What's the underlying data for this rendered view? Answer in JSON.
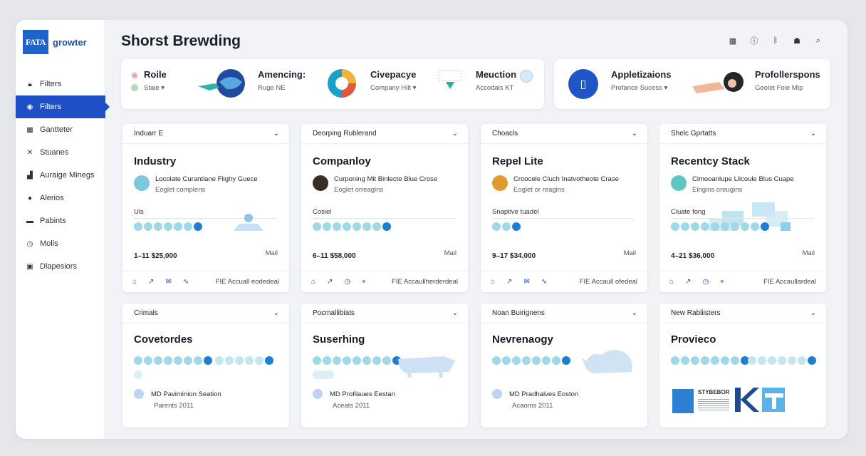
{
  "app": {
    "brand_logo": "FATA",
    "brand_name": "growter"
  },
  "page_title": "Shorst Brewding",
  "sidebar": {
    "items": [
      {
        "label": "Filters",
        "icon": "lock-icon",
        "active": false
      },
      {
        "label": "Filters",
        "icon": "filter-icon",
        "active": true
      },
      {
        "label": "Gantteter",
        "icon": "calendar-icon",
        "active": false
      },
      {
        "label": "Stuanes",
        "icon": "close-icon",
        "active": false
      },
      {
        "label": "Auraige Minegs",
        "icon": "chart-icon",
        "active": false
      },
      {
        "label": "Alerios",
        "icon": "user-icon",
        "active": false
      },
      {
        "label": "Pabints",
        "icon": "card-icon",
        "active": false
      },
      {
        "label": "Molis",
        "icon": "clock-icon",
        "active": false
      },
      {
        "label": "Dlapesiors",
        "icon": "gallery-icon",
        "active": false
      }
    ]
  },
  "top_icons": [
    "grid-icon",
    "info-icon",
    "bluetooth-icon",
    "group-icon",
    "search-icon"
  ],
  "banner1": {
    "seg1": {
      "title": "Roile",
      "sub": "Staie"
    },
    "seg2": {
      "title": "Amencing:",
      "sub": "Ruge NE"
    },
    "seg3": {
      "title": "Civepacye",
      "sub": "Company Hilt"
    },
    "seg4": {
      "title": "Meuction",
      "sub": "Accodals KT"
    }
  },
  "banner2": {
    "seg1": {
      "title": "Appletizaions",
      "sub": "Profance Sucess"
    },
    "seg2": {
      "title": "Profollerspons",
      "sub": "Geolet Foie Mtp"
    }
  },
  "cards_row1": [
    {
      "header": "Induarr E",
      "title": "Industry",
      "sub1": "Locolate Curantlane Flighy Guece",
      "sub2": "Eoglet complens",
      "small_label": "Uls",
      "range": "1–11 $25,000",
      "mail": "Mail",
      "footer": "FIE Accuall eodedeal",
      "avatar_color": "#7fc6e0"
    },
    {
      "header": "Deorping Rublerand",
      "title": "Companloy",
      "sub1": "Curponing Mit Binlecte Blue Crose",
      "sub2": "Eoglet orreagins",
      "small_label": "Cosiel",
      "range": "6–11 $58,000",
      "mail": "Mail",
      "footer": "FIE Accaullherderdeal",
      "avatar_color": "#3a2c28"
    },
    {
      "header": "Choacls",
      "title": "Repel Lite",
      "sub1": "Croocele Cluch Inatvotheote Crase",
      "sub2": "Eoglet or reagins",
      "small_label": "Snaptive tuadel",
      "range": "9–17 $34,000",
      "mail": "Mail",
      "footer": "FIE Accaull ofedeal",
      "avatar_color": "#e29a2e"
    },
    {
      "header": "Shelc Gprtatts",
      "title": "Recentcy Stack",
      "sub1": "Cimooanlupe Llicoule Blus Cuape",
      "sub2": "Eingins oreugins",
      "small_label": "Cluate fong",
      "range": "4–21 $36,000",
      "mail": "Mail",
      "footer": "FIE Accaullardeal",
      "avatar_color": "#5fc7c0"
    }
  ],
  "cards_row2": [
    {
      "header": "Crimals",
      "title": "Covetordes",
      "item": "MD Paviminion Seation",
      "item_sub": "Parents 2011"
    },
    {
      "header": "Pocmallibiats",
      "title": "Suserhing",
      "item": "MD Profilaues Eestan",
      "item_sub": "Aceats 2011"
    },
    {
      "header": "Noan Buirignens",
      "title": "Nevrenaogy",
      "item": "MD Pradhalves Eoston",
      "item_sub": "Acaoms 2011"
    },
    {
      "header": "New Rabliisters",
      "title": "Provieco",
      "logo_text": "STYBEBOR"
    }
  ],
  "colors": {
    "accent": "#1e4fc4",
    "brand": "#1e63c9",
    "pill": "#9fd8e6",
    "pill_dark": "#1e7fd0"
  }
}
